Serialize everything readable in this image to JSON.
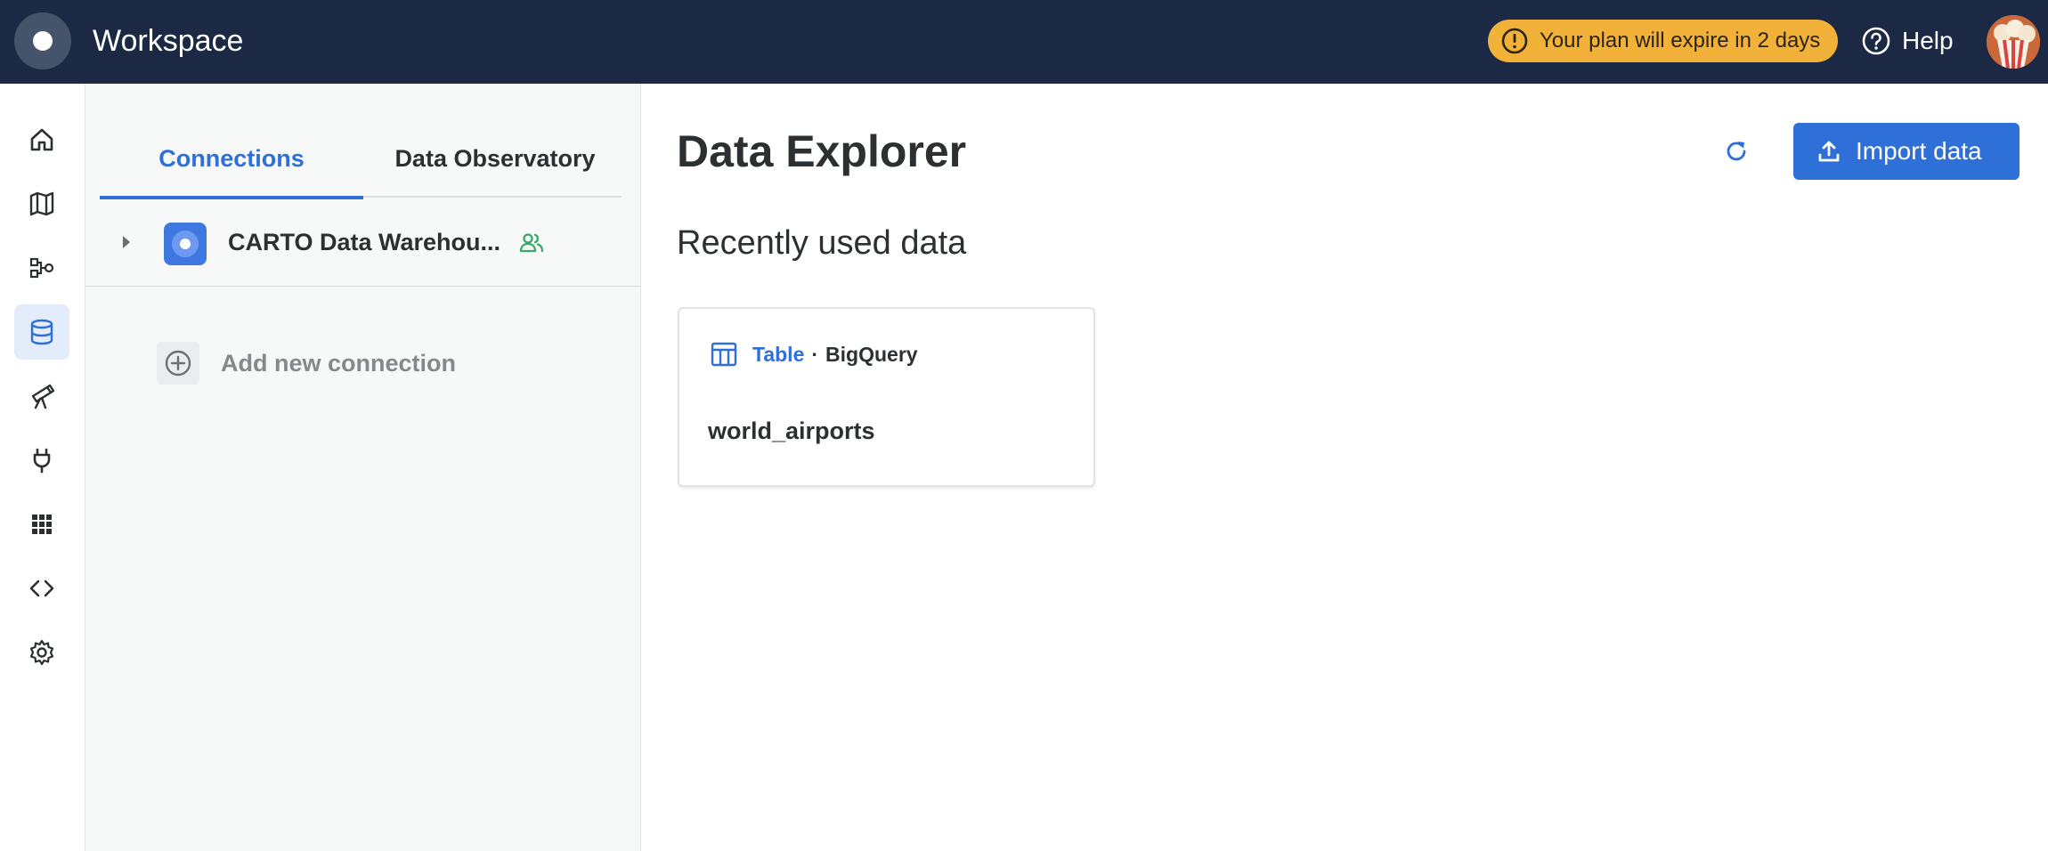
{
  "app": {
    "title": "Workspace",
    "plan_notice": "Your plan will expire in 2 days",
    "help_label": "Help"
  },
  "rail": {
    "items": [
      {
        "name": "home-icon",
        "active": false
      },
      {
        "name": "map-icon",
        "active": false
      },
      {
        "name": "workflows-icon",
        "active": false
      },
      {
        "name": "database-icon",
        "active": true
      },
      {
        "name": "telescope-icon",
        "active": false
      },
      {
        "name": "plug-icon",
        "active": false
      },
      {
        "name": "apps-grid-icon",
        "active": false
      },
      {
        "name": "code-icon",
        "active": false
      },
      {
        "name": "gear-icon",
        "active": false
      }
    ]
  },
  "panel": {
    "tabs": [
      {
        "label": "Connections",
        "active": true
      },
      {
        "label": "Data Observatory",
        "active": false
      }
    ],
    "connection": {
      "name": "CARTO Data Warehou..."
    },
    "add_connection_label": "Add new connection"
  },
  "main": {
    "title": "Data Explorer",
    "import_label": "Import data",
    "section_title": "Recently used data",
    "recent": [
      {
        "type": "Table",
        "separator": "·",
        "provider": "BigQuery",
        "name": "world_airports"
      }
    ]
  },
  "colors": {
    "topbar": "#1b2944",
    "accent": "#2f6fd8",
    "badge": "#f2b23a",
    "shared": "#3aa86b"
  }
}
